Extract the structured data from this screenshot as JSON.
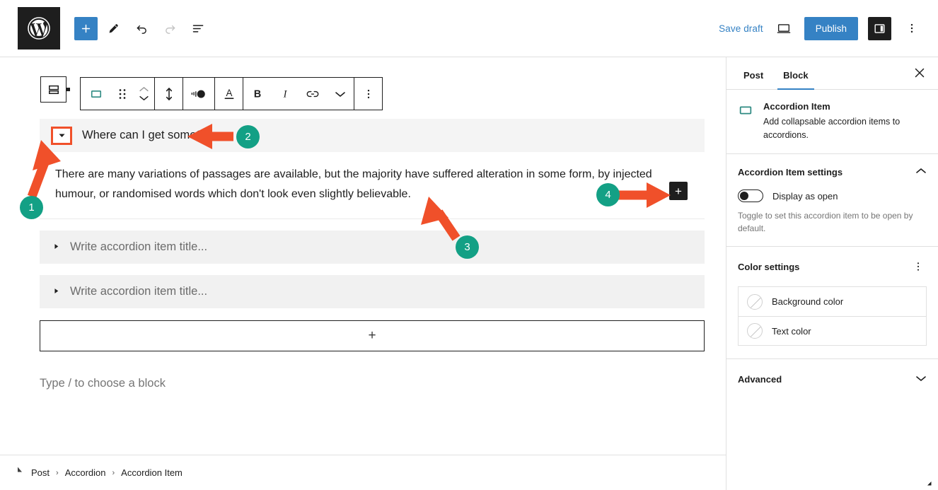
{
  "app": {
    "logo_icon": "wordpress-logo-icon"
  },
  "topbar": {
    "add_block_label": "+",
    "tools": [
      {
        "name": "add-block-button",
        "icon": "plus-icon"
      },
      {
        "name": "edit-tool-button",
        "icon": "pencil-icon"
      },
      {
        "name": "undo-button",
        "icon": "undo-arrow-icon"
      },
      {
        "name": "redo-button",
        "icon": "redo-arrow-icon"
      },
      {
        "name": "document-overview-button",
        "icon": "list-view-icon"
      }
    ],
    "save_draft_label": "Save draft",
    "preview_icon": "desktop-preview-icon",
    "publish_label": "Publish",
    "settings_icon": "sidebar-panel-icon",
    "options_icon": "vertical-dots-icon",
    "accent_blue": "#3582c4",
    "dark": "#1e1e1e"
  },
  "block_toolbar": {
    "block_switcher_icon": "accordion-block-icon",
    "tools": [
      {
        "name": "block-type-accordion-item-icon",
        "icon": "accordion-item-icon"
      },
      {
        "name": "drag-handle",
        "icon": "drag-dots-icon"
      },
      {
        "name": "move-updown-buttons",
        "icon": "chevron-up-down-icon"
      },
      {
        "name": "vertical-align-button",
        "icon": "vertical-arrows-icon"
      },
      {
        "name": "contrast-button",
        "icon": "contrast-icon"
      },
      {
        "name": "text-color-button",
        "icon": "underlined-a-icon"
      },
      {
        "name": "bold-button",
        "icon": "bold-icon"
      },
      {
        "name": "italic-button",
        "icon": "italic-icon"
      },
      {
        "name": "link-button",
        "icon": "link-icon"
      },
      {
        "name": "more-rich-text-button",
        "icon": "chevron-down-icon"
      },
      {
        "name": "block-options-button",
        "icon": "vertical-dots-icon"
      }
    ],
    "bold_label": "B",
    "italic_label": "I",
    "text_color_label": "A"
  },
  "editor": {
    "open_item": {
      "title": "Where can I get some?",
      "caret_icon": "caret-down-icon",
      "paragraph": "There are many variations of passages are available, but the majority have suffered alteration in some form, by injected humour, or randomised words which don't look even slightly believable.",
      "add_inner_block_label": "+"
    },
    "closed_items": [
      {
        "caret_icon": "caret-right-icon",
        "placeholder": "Write accordion item title..."
      },
      {
        "caret_icon": "caret-right-icon",
        "placeholder": "Write accordion item title..."
      }
    ],
    "appender_label": "+",
    "slash_hint": "Type / to choose a block"
  },
  "breadcrumb": {
    "items": [
      "Post",
      "Accordion",
      "Accordion Item"
    ],
    "separator": "›"
  },
  "sidebar": {
    "tabs": [
      {
        "label": "Post",
        "active": false
      },
      {
        "label": "Block",
        "active": true
      }
    ],
    "close_icon": "close-icon",
    "block_card": {
      "icon": "accordion-item-icon",
      "title": "Accordion Item",
      "description": "Add collapsable accordion items to accordions."
    },
    "settings_panel": {
      "title": "Accordion Item settings",
      "collapse_icon": "chevron-up-icon",
      "toggle_label": "Display as open",
      "toggle_on": false,
      "help_text": "Toggle to set this accordion item to be open by default."
    },
    "color_panel": {
      "title": "Color settings",
      "options_icon": "vertical-dots-icon",
      "rows": [
        {
          "label": "Background color",
          "swatch": "none"
        },
        {
          "label": "Text color",
          "swatch": "none"
        }
      ]
    },
    "advanced_panel": {
      "title": "Advanced",
      "expand_icon": "chevron-down-icon"
    }
  },
  "annotations": {
    "accent_green": "#13a085",
    "accent_orange": "#f0502a",
    "markers": [
      {
        "number": "1",
        "target": "accordion-caret-toggle"
      },
      {
        "number": "2",
        "target": "accordion-item-title"
      },
      {
        "number": "3",
        "target": "accordion-item-content"
      },
      {
        "number": "4",
        "target": "accordion-inner-block-appender"
      }
    ]
  }
}
